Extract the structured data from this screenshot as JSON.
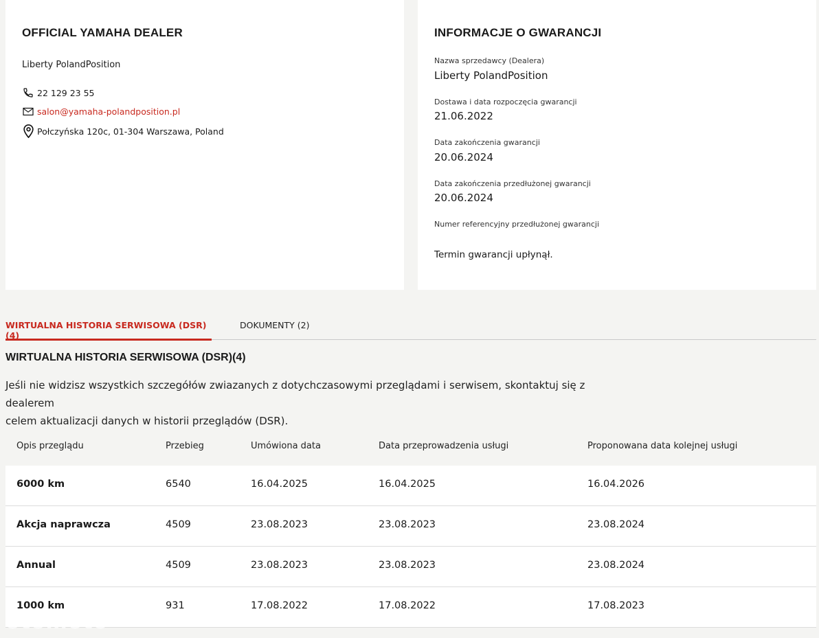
{
  "dealer": {
    "title": "OFFICIAL YAMAHA DEALER",
    "name": "Liberty PolandPosition",
    "phone": "22 129 23 55",
    "email": "salon@yamaha-polandposition.pl",
    "address": "Połczyńska 120c, 01-304 Warszawa, Poland",
    "icons": [
      "phone-icon",
      "mail-icon",
      "location-pin-icon"
    ]
  },
  "warranty": {
    "title": "INFORMACJE O GWARANCJI",
    "seller_label": "Nazwa sprzedawcy (Dealera)",
    "seller_value": "Liberty PolandPosition",
    "start_label": "Dostawa i data rozpoczęcia gwarancji",
    "start_value": "21.06.2022",
    "end_label": "Data zakończenia gwarancji",
    "end_value": "20.06.2024",
    "ext_end_label": "Data zakończenia przedłużonej gwarancji",
    "ext_end_value": "20.06.2024",
    "ext_ref_label": "Numer referencyjny przedłużonej gwarancji",
    "note": "Termin gwarancji upłynął."
  },
  "tabs": {
    "active": "WIRTUALNA HISTORIA SERWISOWA (DSR) (4)",
    "documents": "DOKUMENTY (2)"
  },
  "history": {
    "title": "WIRTUALNA HISTORIA SERWISOWA (DSR)(4)",
    "description_line1": "Jeśli nie widzisz wszystkich szczegółów zwiazanych z dotychczasowymi przeglądami i serwisem, skontaktuj się z dealerem",
    "description_line2": "celem aktualizacji danych w historii przeglądów (DSR).",
    "columns": [
      "Opis przeglądu",
      "Przebieg",
      "Umówiona data",
      "Data przeprowadzenia usługi",
      "Proponowana data kolejnej usługi"
    ],
    "rows": [
      [
        "6000 km",
        "6540",
        "16.04.2025",
        "16.04.2025",
        "16.04.2026"
      ],
      [
        "Akcja naprawcza",
        "4509",
        "23.08.2023",
        "23.08.2023",
        "23.08.2024"
      ],
      [
        "Annual",
        "4509",
        "23.08.2023",
        "23.08.2023",
        "23.08.2024"
      ],
      [
        "1000 km",
        "931",
        "17.08.2022",
        "17.08.2022",
        "17.08.2023"
      ]
    ]
  },
  "watermark": "otomoto",
  "colors": {
    "accent": "#c8291f",
    "background": "#f4f4f2",
    "card": "#ffffff"
  }
}
